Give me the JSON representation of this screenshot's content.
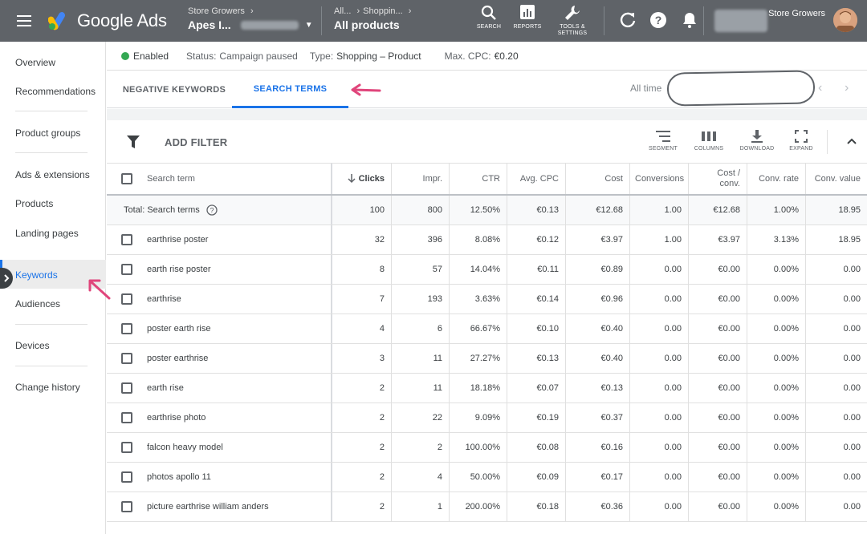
{
  "app": {
    "product_name": "Google Ads",
    "account_parent": "Store Growers",
    "account_name": "Apes I...",
    "campaign_breadcrumb_1": "All...",
    "campaign_breadcrumb_2": "Shoppin...",
    "campaign_title": "All products",
    "user_name": "Store Growers"
  },
  "top_tools": [
    {
      "label": "SEARCH",
      "icon": "search-icon"
    },
    {
      "label": "REPORTS",
      "icon": "reports-icon"
    },
    {
      "label": "TOOLS & SETTINGS",
      "icon": "wrench-icon"
    }
  ],
  "sidebar": {
    "items": [
      {
        "label": "Overview"
      },
      {
        "label": "Recommendations"
      },
      {
        "label": "Product groups"
      },
      {
        "label": "Ads & extensions"
      },
      {
        "label": "Products"
      },
      {
        "label": "Landing pages"
      },
      {
        "label": "Keywords",
        "active": true
      },
      {
        "label": "Audiences"
      },
      {
        "label": "Devices"
      },
      {
        "label": "Change history"
      }
    ]
  },
  "status_bar": {
    "state": "Enabled",
    "status_key": "Status:",
    "status_value": "Campaign paused",
    "type_key": "Type:",
    "type_value": "Shopping – Product",
    "maxcpc_key": "Max. CPC:",
    "maxcpc_value": "€0.20"
  },
  "tabs": {
    "negative": "NEGATIVE KEYWORDS",
    "search_terms": "SEARCH TERMS",
    "date_label": "All time"
  },
  "toolbar": {
    "add_filter": "ADD FILTER",
    "tools": [
      {
        "label": "SEGMENT",
        "icon": "segment-icon"
      },
      {
        "label": "COLUMNS",
        "icon": "columns-icon"
      },
      {
        "label": "DOWNLOAD",
        "icon": "download-icon"
      },
      {
        "label": "EXPAND",
        "icon": "expand-icon"
      }
    ]
  },
  "table": {
    "headers": [
      "Search term",
      "Clicks",
      "Impr.",
      "CTR",
      "Avg. CPC",
      "Cost",
      "Conversions",
      "Cost / conv.",
      "Conv. rate",
      "Conv. value"
    ],
    "total": {
      "label": "Total: Search terms",
      "values": [
        "100",
        "800",
        "12.50%",
        "€0.13",
        "€12.68",
        "1.00",
        "€12.68",
        "1.00%",
        "18.95"
      ]
    },
    "rows": [
      {
        "term": "earthrise poster",
        "values": [
          "32",
          "396",
          "8.08%",
          "€0.12",
          "€3.97",
          "1.00",
          "€3.97",
          "3.13%",
          "18.95"
        ]
      },
      {
        "term": "earth rise poster",
        "values": [
          "8",
          "57",
          "14.04%",
          "€0.11",
          "€0.89",
          "0.00",
          "€0.00",
          "0.00%",
          "0.00"
        ]
      },
      {
        "term": "earthrise",
        "values": [
          "7",
          "193",
          "3.63%",
          "€0.14",
          "€0.96",
          "0.00",
          "€0.00",
          "0.00%",
          "0.00"
        ]
      },
      {
        "term": "poster earth rise",
        "values": [
          "4",
          "6",
          "66.67%",
          "€0.10",
          "€0.40",
          "0.00",
          "€0.00",
          "0.00%",
          "0.00"
        ]
      },
      {
        "term": "poster earthrise",
        "values": [
          "3",
          "11",
          "27.27%",
          "€0.13",
          "€0.40",
          "0.00",
          "€0.00",
          "0.00%",
          "0.00"
        ]
      },
      {
        "term": "earth rise",
        "values": [
          "2",
          "11",
          "18.18%",
          "€0.07",
          "€0.13",
          "0.00",
          "€0.00",
          "0.00%",
          "0.00"
        ]
      },
      {
        "term": "earthrise photo",
        "values": [
          "2",
          "22",
          "9.09%",
          "€0.19",
          "€0.37",
          "0.00",
          "€0.00",
          "0.00%",
          "0.00"
        ]
      },
      {
        "term": "falcon heavy model",
        "values": [
          "2",
          "2",
          "100.00%",
          "€0.08",
          "€0.16",
          "0.00",
          "€0.00",
          "0.00%",
          "0.00"
        ]
      },
      {
        "term": "photos apollo 11",
        "values": [
          "2",
          "4",
          "50.00%",
          "€0.09",
          "€0.17",
          "0.00",
          "€0.00",
          "0.00%",
          "0.00"
        ]
      },
      {
        "term": "picture earthrise william anders",
        "values": [
          "2",
          "1",
          "200.00%",
          "€0.18",
          "€0.36",
          "0.00",
          "€0.00",
          "0.00%",
          "0.00"
        ]
      }
    ]
  },
  "colors": {
    "topbar": "#5f6368",
    "accent": "#1a73e8",
    "enabled": "#34a853",
    "annotation_arrow": "#e0457b"
  }
}
